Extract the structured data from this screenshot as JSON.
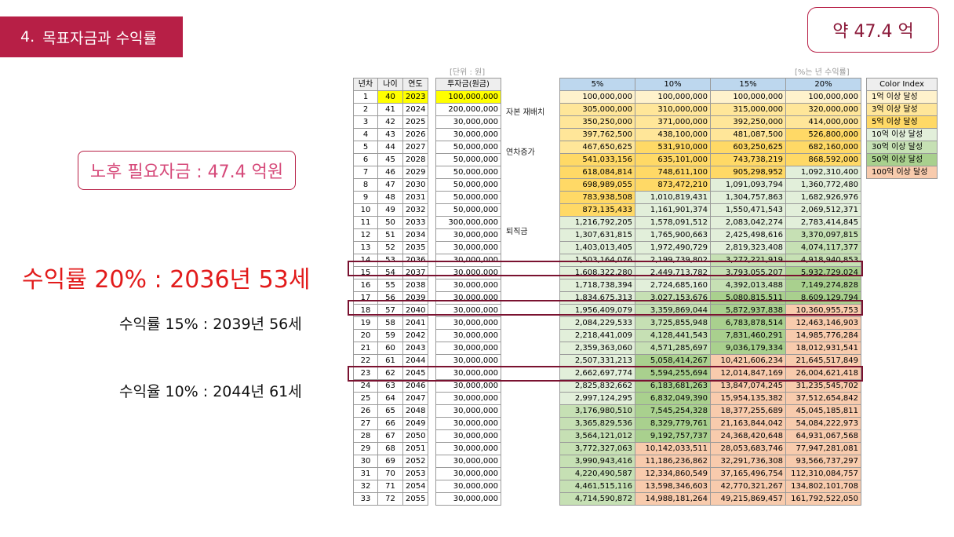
{
  "section": {
    "number": "4.",
    "title": "목표자금과 수익률"
  },
  "total_badge": "약 47.4 억",
  "required_box": "노후 필요자금 : 47.4 억원",
  "annotations": [
    "수익률 20% : 2036년 53세",
    "수익률 15% : 2039년 56세",
    "수익율 10% : 2044년 61세"
  ],
  "unit_label": "[단위 : 원]",
  "rate_label": "[%는 년 수익률]",
  "left_headers": [
    "년차",
    "나이",
    "연도"
  ],
  "invest_header": "투자금(원금)",
  "rate_headers": [
    "5%",
    "10%",
    "15%",
    "20%"
  ],
  "side_notes": [
    "자본 재배치",
    "연차증가",
    "퇴직금"
  ],
  "color_index": {
    "header": "Color Index",
    "items": [
      {
        "label": "1억 이상 달성",
        "color": "#fff2cc"
      },
      {
        "label": "3억 이상 달성",
        "color": "#ffe699"
      },
      {
        "label": "5억 이상 달성",
        "color": "#ffd966"
      },
      {
        "label": "10억 이상 달성",
        "color": "#e2efda"
      },
      {
        "label": "30억 이상 달성",
        "color": "#c6e0b4"
      },
      {
        "label": "50억 이상 달성",
        "color": "#a9d08e"
      },
      {
        "label": "100억 이상 달성",
        "color": "#f8cbad"
      }
    ]
  },
  "rows": [
    {
      "year": "1",
      "age": "40",
      "cal": "2023",
      "invest": "100,000,000",
      "v": [
        "100,000,000",
        "100,000,000",
        "100,000,000",
        "100,000,000"
      ]
    },
    {
      "year": "2",
      "age": "41",
      "cal": "2024",
      "invest": "200,000,000",
      "v": [
        "305,000,000",
        "310,000,000",
        "315,000,000",
        "320,000,000"
      ]
    },
    {
      "year": "3",
      "age": "42",
      "cal": "2025",
      "invest": "30,000,000",
      "v": [
        "350,250,000",
        "371,000,000",
        "392,250,000",
        "414,000,000"
      ]
    },
    {
      "year": "4",
      "age": "43",
      "cal": "2026",
      "invest": "30,000,000",
      "v": [
        "397,762,500",
        "438,100,000",
        "481,087,500",
        "526,800,000"
      ]
    },
    {
      "year": "5",
      "age": "44",
      "cal": "2027",
      "invest": "50,000,000",
      "v": [
        "467,650,625",
        "531,910,000",
        "603,250,625",
        "682,160,000"
      ]
    },
    {
      "year": "6",
      "age": "45",
      "cal": "2028",
      "invest": "50,000,000",
      "v": [
        "541,033,156",
        "635,101,000",
        "743,738,219",
        "868,592,000"
      ]
    },
    {
      "year": "7",
      "age": "46",
      "cal": "2029",
      "invest": "50,000,000",
      "v": [
        "618,084,814",
        "748,611,100",
        "905,298,952",
        "1,092,310,400"
      ]
    },
    {
      "year": "8",
      "age": "47",
      "cal": "2030",
      "invest": "50,000,000",
      "v": [
        "698,989,055",
        "873,472,210",
        "1,091,093,794",
        "1,360,772,480"
      ]
    },
    {
      "year": "9",
      "age": "48",
      "cal": "2031",
      "invest": "50,000,000",
      "v": [
        "783,938,508",
        "1,010,819,431",
        "1,304,757,863",
        "1,682,926,976"
      ]
    },
    {
      "year": "10",
      "age": "49",
      "cal": "2032",
      "invest": "50,000,000",
      "v": [
        "873,135,433",
        "1,161,901,374",
        "1,550,471,543",
        "2,069,512,371"
      ]
    },
    {
      "year": "11",
      "age": "50",
      "cal": "2033",
      "invest": "300,000,000",
      "v": [
        "1,216,792,205",
        "1,578,091,512",
        "2,083,042,274",
        "2,783,414,845"
      ]
    },
    {
      "year": "12",
      "age": "51",
      "cal": "2034",
      "invest": "30,000,000",
      "v": [
        "1,307,631,815",
        "1,765,900,663",
        "2,425,498,616",
        "3,370,097,815"
      ]
    },
    {
      "year": "13",
      "age": "52",
      "cal": "2035",
      "invest": "30,000,000",
      "v": [
        "1,403,013,405",
        "1,972,490,729",
        "2,819,323,408",
        "4,074,117,377"
      ]
    },
    {
      "year": "14",
      "age": "53",
      "cal": "2036",
      "invest": "30,000,000",
      "v": [
        "1,503,164,076",
        "2,199,739,802",
        "3,272,221,919",
        "4,918,940,853"
      ]
    },
    {
      "year": "15",
      "age": "54",
      "cal": "2037",
      "invest": "30,000,000",
      "v": [
        "1,608,322,280",
        "2,449,713,782",
        "3,793,055,207",
        "5,932,729,024"
      ]
    },
    {
      "year": "16",
      "age": "55",
      "cal": "2038",
      "invest": "30,000,000",
      "v": [
        "1,718,738,394",
        "2,724,685,160",
        "4,392,013,488",
        "7,149,274,828"
      ]
    },
    {
      "year": "17",
      "age": "56",
      "cal": "2039",
      "invest": "30,000,000",
      "v": [
        "1,834,675,313",
        "3,027,153,676",
        "5,080,815,511",
        "8,609,129,794"
      ]
    },
    {
      "year": "18",
      "age": "57",
      "cal": "2040",
      "invest": "30,000,000",
      "v": [
        "1,956,409,079",
        "3,359,869,044",
        "5,872,937,838",
        "10,360,955,753"
      ]
    },
    {
      "year": "19",
      "age": "58",
      "cal": "2041",
      "invest": "30,000,000",
      "v": [
        "2,084,229,533",
        "3,725,855,948",
        "6,783,878,514",
        "12,463,146,903"
      ]
    },
    {
      "year": "20",
      "age": "59",
      "cal": "2042",
      "invest": "30,000,000",
      "v": [
        "2,218,441,009",
        "4,128,441,543",
        "7,831,460,291",
        "14,985,776,284"
      ]
    },
    {
      "year": "21",
      "age": "60",
      "cal": "2043",
      "invest": "30,000,000",
      "v": [
        "2,359,363,060",
        "4,571,285,697",
        "9,036,179,334",
        "18,012,931,541"
      ]
    },
    {
      "year": "22",
      "age": "61",
      "cal": "2044",
      "invest": "30,000,000",
      "v": [
        "2,507,331,213",
        "5,058,414,267",
        "10,421,606,234",
        "21,645,517,849"
      ]
    },
    {
      "year": "23",
      "age": "62",
      "cal": "2045",
      "invest": "30,000,000",
      "v": [
        "2,662,697,774",
        "5,594,255,694",
        "12,014,847,169",
        "26,004,621,418"
      ]
    },
    {
      "year": "24",
      "age": "63",
      "cal": "2046",
      "invest": "30,000,000",
      "v": [
        "2,825,832,662",
        "6,183,681,263",
        "13,847,074,245",
        "31,235,545,702"
      ]
    },
    {
      "year": "25",
      "age": "64",
      "cal": "2047",
      "invest": "30,000,000",
      "v": [
        "2,997,124,295",
        "6,832,049,390",
        "15,954,135,382",
        "37,512,654,842"
      ]
    },
    {
      "year": "26",
      "age": "65",
      "cal": "2048",
      "invest": "30,000,000",
      "v": [
        "3,176,980,510",
        "7,545,254,328",
        "18,377,255,689",
        "45,045,185,811"
      ]
    },
    {
      "year": "27",
      "age": "66",
      "cal": "2049",
      "invest": "30,000,000",
      "v": [
        "3,365,829,536",
        "8,329,779,761",
        "21,163,844,042",
        "54,084,222,973"
      ]
    },
    {
      "year": "28",
      "age": "67",
      "cal": "2050",
      "invest": "30,000,000",
      "v": [
        "3,564,121,012",
        "9,192,757,737",
        "24,368,420,648",
        "64,931,067,568"
      ]
    },
    {
      "year": "29",
      "age": "68",
      "cal": "2051",
      "invest": "30,000,000",
      "v": [
        "3,772,327,063",
        "10,142,033,511",
        "28,053,683,746",
        "77,947,281,081"
      ]
    },
    {
      "year": "30",
      "age": "69",
      "cal": "2052",
      "invest": "30,000,000",
      "v": [
        "3,990,943,416",
        "11,186,236,862",
        "32,291,736,308",
        "93,566,737,297"
      ]
    },
    {
      "year": "31",
      "age": "70",
      "cal": "2053",
      "invest": "30,000,000",
      "v": [
        "4,220,490,587",
        "12,334,860,549",
        "37,165,496,754",
        "112,310,084,757"
      ]
    },
    {
      "year": "32",
      "age": "71",
      "cal": "2054",
      "invest": "30,000,000",
      "v": [
        "4,461,515,116",
        "13,598,346,603",
        "42,770,321,267",
        "134,802,101,708"
      ]
    },
    {
      "year": "33",
      "age": "72",
      "cal": "2055",
      "invest": "30,000,000",
      "v": [
        "4,714,590,872",
        "14,988,181,264",
        "49,215,869,457",
        "161,792,522,050"
      ]
    }
  ]
}
